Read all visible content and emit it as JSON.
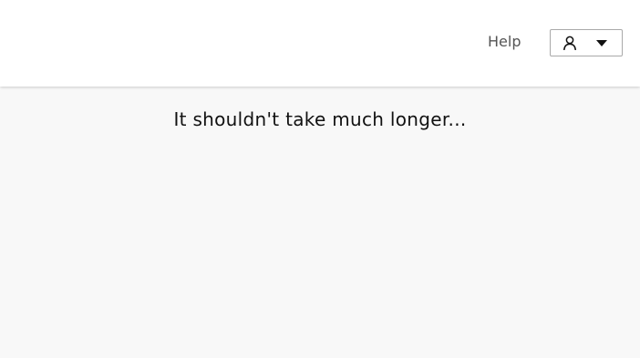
{
  "header": {
    "help_label": "Help",
    "user_menu": {
      "icon": "user-icon",
      "caret": "caret-down-icon"
    }
  },
  "main": {
    "loading_message": "It shouldn't take much longer..."
  },
  "colors": {
    "header_bg": "#ffffff",
    "page_bg": "#f8f8f8",
    "text": "#111111",
    "muted_text": "#555555",
    "border": "#a9a9a9"
  }
}
